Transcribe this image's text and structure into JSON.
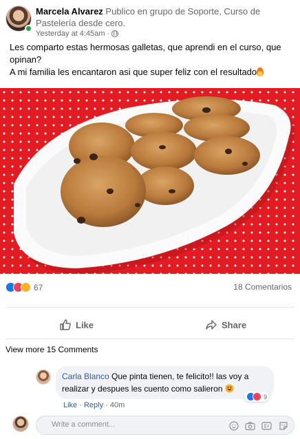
{
  "post": {
    "author": "Marcela Alvarez",
    "context": " Publico en grupo de Soporte, Curso de Pastelería desde cero.",
    "timestamp": "Yesterday at 4:45am",
    "separator": "·",
    "text_line1": "Les comparto estas hermosas galletas, que aprendi en el curso, que opinan?",
    "text_line2": "A mi familia les encantaron asi que super feliz con el resultado",
    "image_icon": "cookies-photo"
  },
  "stats": {
    "reaction_icons": [
      "like-icon",
      "love-icon",
      "wow-icon"
    ],
    "reaction_count": "67",
    "comments": "18 Comentarios"
  },
  "actions": {
    "like": "Like",
    "share": "Share"
  },
  "comments": {
    "view_more": "View more 15 Comments",
    "items": [
      {
        "author": "Carla Blanco",
        "text": " Que pinta tienen, te felicito!! las voy a realizar y despues les cuento como salieron",
        "reaction_count": "9",
        "like": "Like",
        "reply": "Reply",
        "time": "40m",
        "sep": " · "
      }
    ]
  },
  "composer": {
    "placeholder": "Write a comment...",
    "tools": [
      "emoji-icon",
      "camera-icon",
      "gif-icon",
      "sticker-icon"
    ]
  },
  "colors": {
    "accent": "#1877f2",
    "love": "#f33e58",
    "wow": "#f7b125",
    "link": "#385898",
    "tablecloth": "#e31b23"
  }
}
